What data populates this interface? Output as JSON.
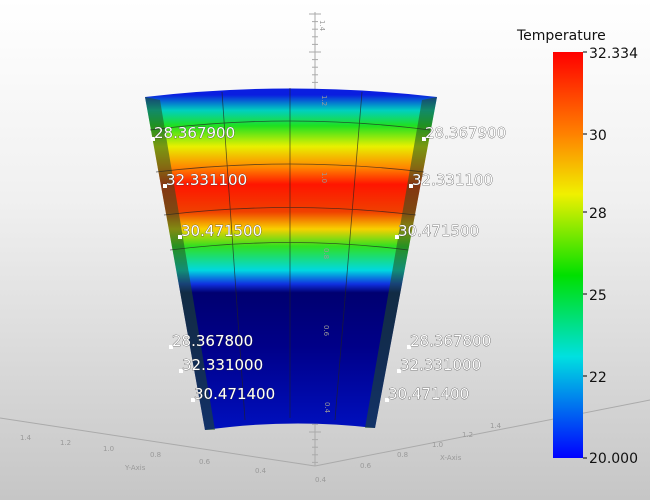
{
  "viewport": {
    "colorbar": {
      "title": "Temperature",
      "ticks": [
        "32.334",
        "30",
        "28",
        "25",
        "22",
        "20.000"
      ],
      "range": [
        20.0,
        32.334
      ],
      "colormap": "rainbow (blue-to-red)"
    },
    "axes": {
      "z_ticks": [
        "1.4",
        "1.2",
        "1.0",
        "0.8",
        "0.6",
        "0.4"
      ],
      "y_label": "Y-Axis",
      "y_ticks": [
        "1.4",
        "1.2",
        "1.0",
        "0.8",
        "0.6",
        "0.4"
      ],
      "x_label": "X-Axis",
      "x_ticks": [
        "0.4",
        "0.6",
        "0.8",
        "1.0",
        "1.2",
        "1.4"
      ]
    },
    "probe_labels": [
      {
        "value": "28.367900",
        "side": "left"
      },
      {
        "value": "28.367900",
        "side": "right"
      },
      {
        "value": "32.331100",
        "side": "left"
      },
      {
        "value": "32.331100",
        "side": "right"
      },
      {
        "value": "30.471500",
        "side": "left"
      },
      {
        "value": "30.471500",
        "side": "right"
      },
      {
        "value": "28.367800",
        "side": "left"
      },
      {
        "value": "28.367800",
        "side": "right"
      },
      {
        "value": "32.331000",
        "side": "left"
      },
      {
        "value": "32.331000",
        "side": "right"
      },
      {
        "value": "30.471400",
        "side": "left"
      },
      {
        "value": "30.471400",
        "side": "right"
      }
    ]
  }
}
